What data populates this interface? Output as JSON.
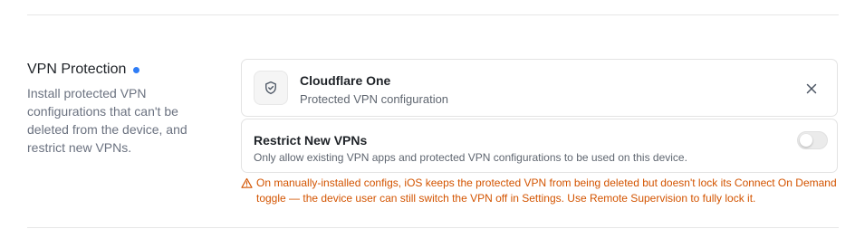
{
  "section": {
    "title": "VPN Protection",
    "description": "Install protected VPN configurations that can't be deleted from the device, and restrict new VPNs."
  },
  "config": {
    "name": "Cloudflare One",
    "subtitle": "Protected VPN configuration",
    "icon": "shield-check-icon",
    "close_icon": "close-icon"
  },
  "restrict": {
    "title": "Restrict New VPNs",
    "description": "Only allow existing VPN apps and protected VPN configurations to be used on this device.",
    "enabled": false
  },
  "warning": {
    "icon": "warning-triangle-icon",
    "text": "On manually-installed configs, iOS keeps the protected VPN from being deleted but doesn't lock its Connect On Demand toggle — the device user can still switch the VPN off in Settings. Use Remote Supervision to fully lock it."
  },
  "colors": {
    "accent_dot": "#2f7df6",
    "warning": "#d35400",
    "border": "#e3e3e3",
    "muted_text": "#6b7280"
  }
}
